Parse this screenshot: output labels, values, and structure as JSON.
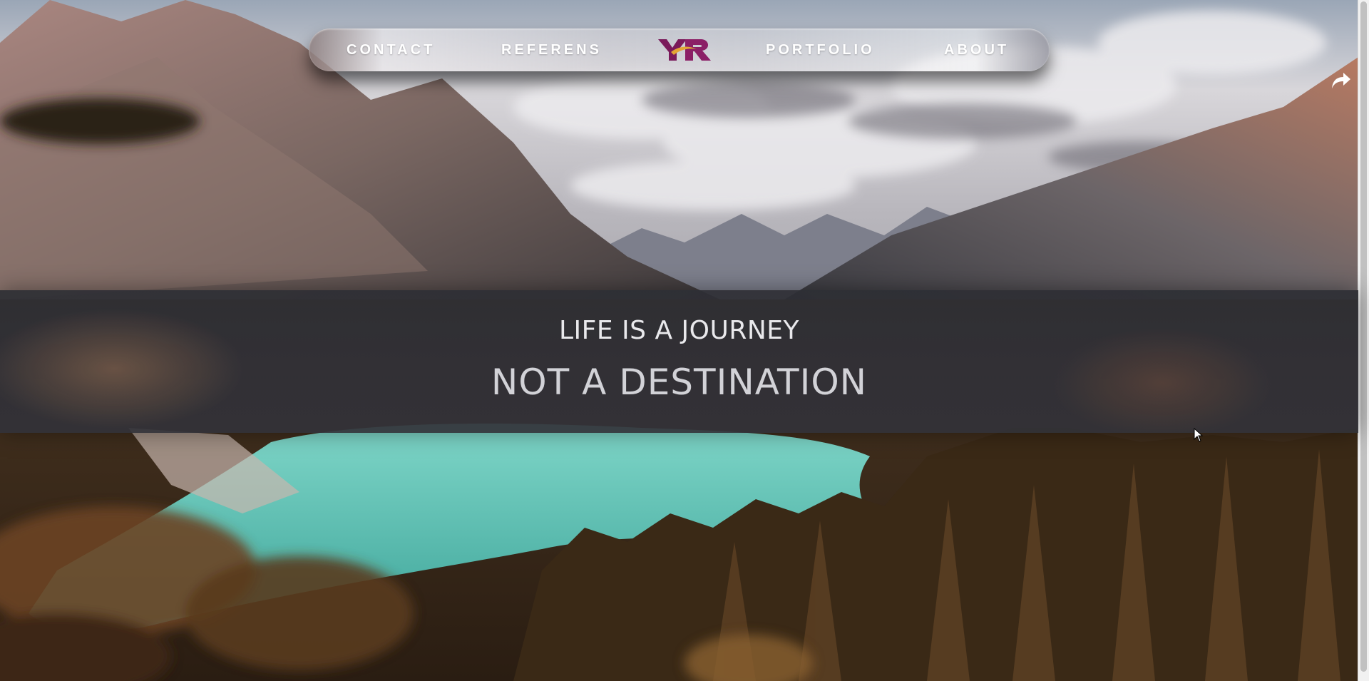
{
  "nav": {
    "links": [
      {
        "label": "CONTACT"
      },
      {
        "label": "REFERENS"
      },
      {
        "label": "PORTFOLIO"
      },
      {
        "label": "ABOUT"
      }
    ],
    "logo_text": "YR",
    "logo_colors": {
      "primary": "#7a1a5a",
      "accent": "#e0a030"
    }
  },
  "hero": {
    "tagline_line1": "LIFE IS A JOURNEY",
    "tagline_line2": "NOT A DESTINATION"
  },
  "icons": {
    "share": "share-arrow-icon",
    "cursor": "mouse-pointer"
  },
  "colors": {
    "band_bg": "#2f3036",
    "lake": "#4fbfb0",
    "forest": "#3b2a1c",
    "sky": "#c9c9d0"
  }
}
